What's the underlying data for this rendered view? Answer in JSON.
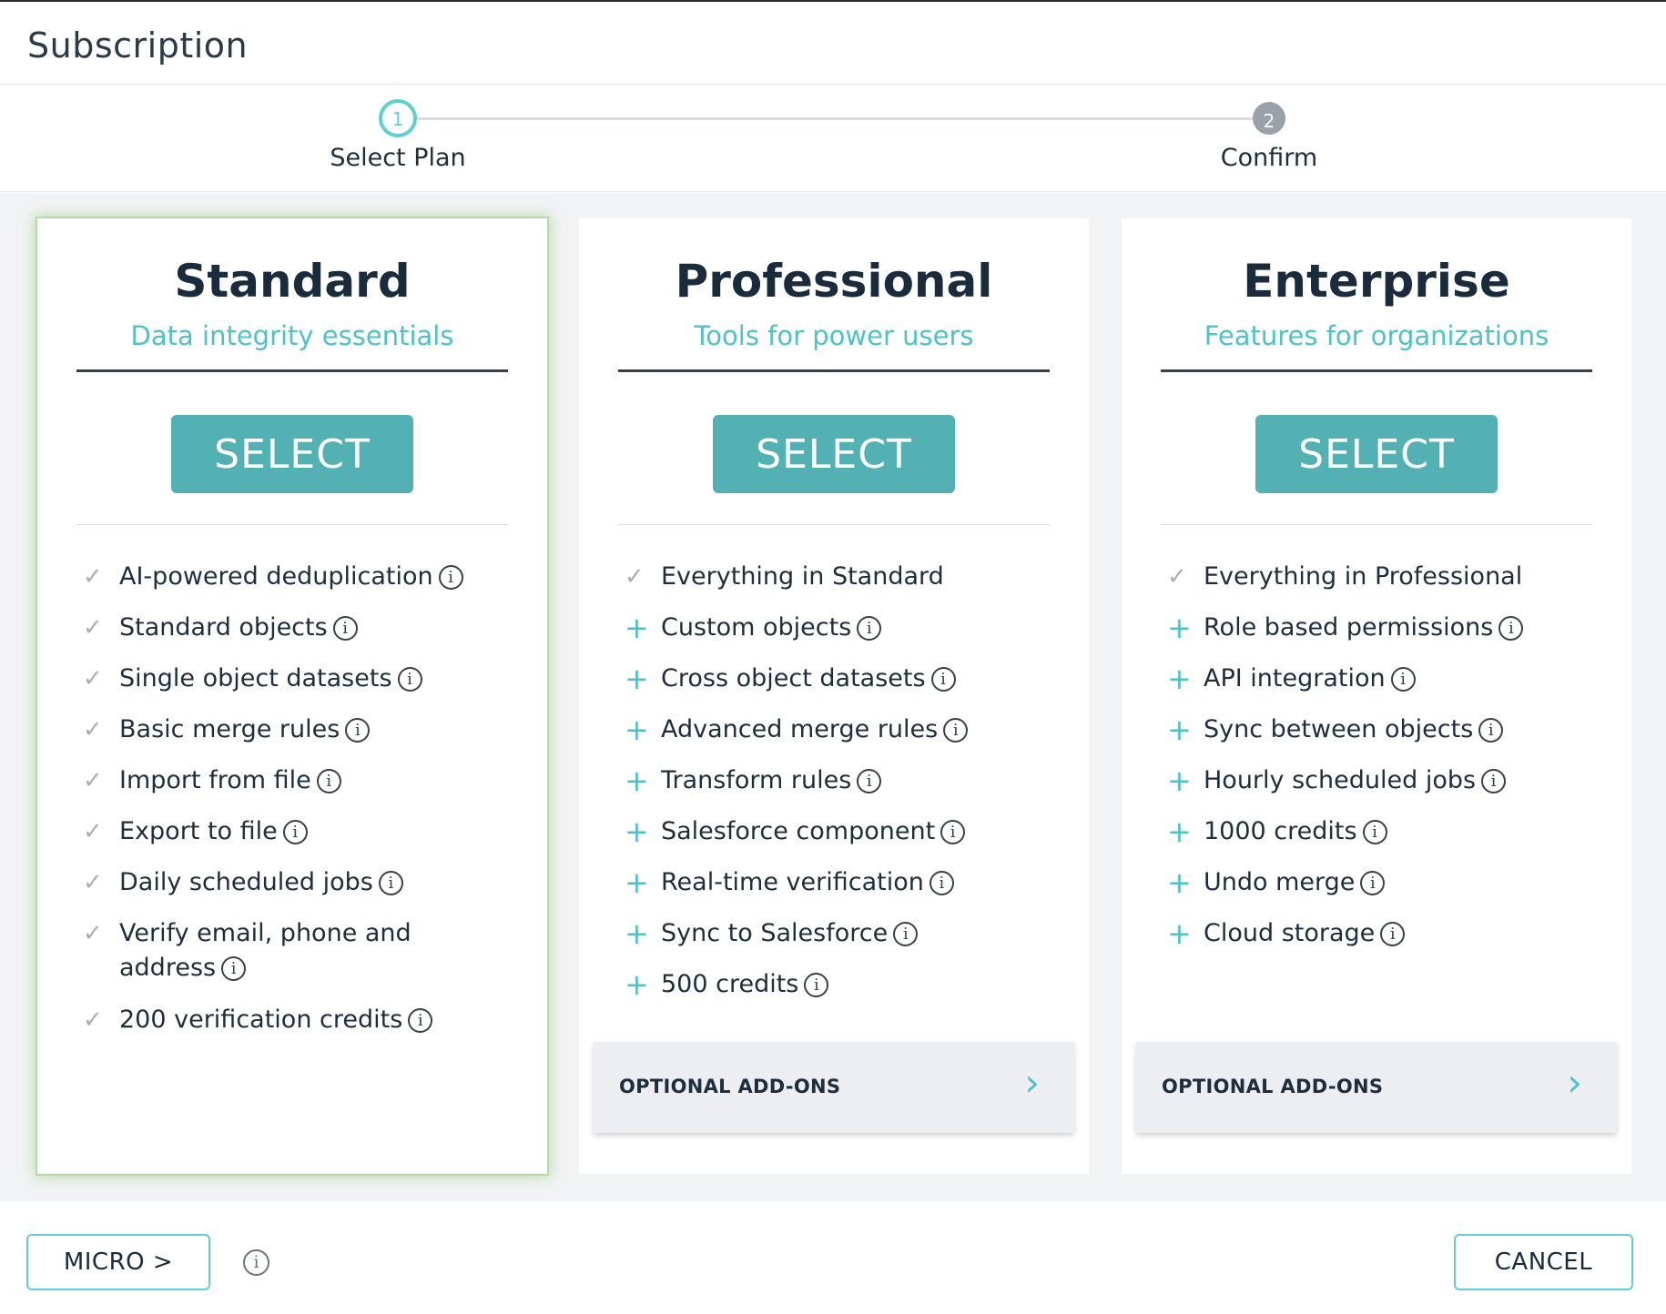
{
  "header": {
    "title": "Subscription"
  },
  "stepper": {
    "steps": [
      {
        "number": "1",
        "label": "Select Plan"
      },
      {
        "number": "2",
        "label": "Confirm"
      }
    ]
  },
  "plans": [
    {
      "name": "Standard",
      "tagline": "Data integrity essentials",
      "select_label": "SELECT",
      "features": [
        "AI-powered deduplication",
        "Standard objects",
        "Single object datasets",
        "Basic merge rules",
        "Import from file",
        "Export to file",
        "Daily scheduled jobs",
        "Verify email, phone and address",
        "200 verification credits"
      ]
    },
    {
      "name": "Professional",
      "tagline": "Tools for power users",
      "select_label": "SELECT",
      "features": [
        "Everything in Standard",
        "Custom objects",
        "Cross object datasets",
        "Advanced merge rules",
        "Transform rules",
        "Salesforce component",
        "Real-time verification",
        "Sync to Salesforce",
        "500 credits"
      ],
      "addons_label": "OPTIONAL ADD-ONS"
    },
    {
      "name": "Enterprise",
      "tagline": "Features for organizations",
      "select_label": "SELECT",
      "features": [
        "Everything in Professional",
        "Role based permissions",
        "API integration",
        "Sync between objects",
        "Hourly scheduled jobs",
        "1000 credits",
        "Undo merge",
        "Cloud storage"
      ],
      "addons_label": "OPTIONAL ADD-ONS"
    }
  ],
  "footer": {
    "micro_label": "MICRO >",
    "cancel_label": "CANCEL"
  },
  "icons": {
    "check": "✓",
    "plus": "+",
    "info": "i",
    "chevron": "›"
  },
  "colors": {
    "accent": "#53b0b3",
    "teal_text": "#4fc1c8",
    "selected_glow": "#b8dba5"
  }
}
